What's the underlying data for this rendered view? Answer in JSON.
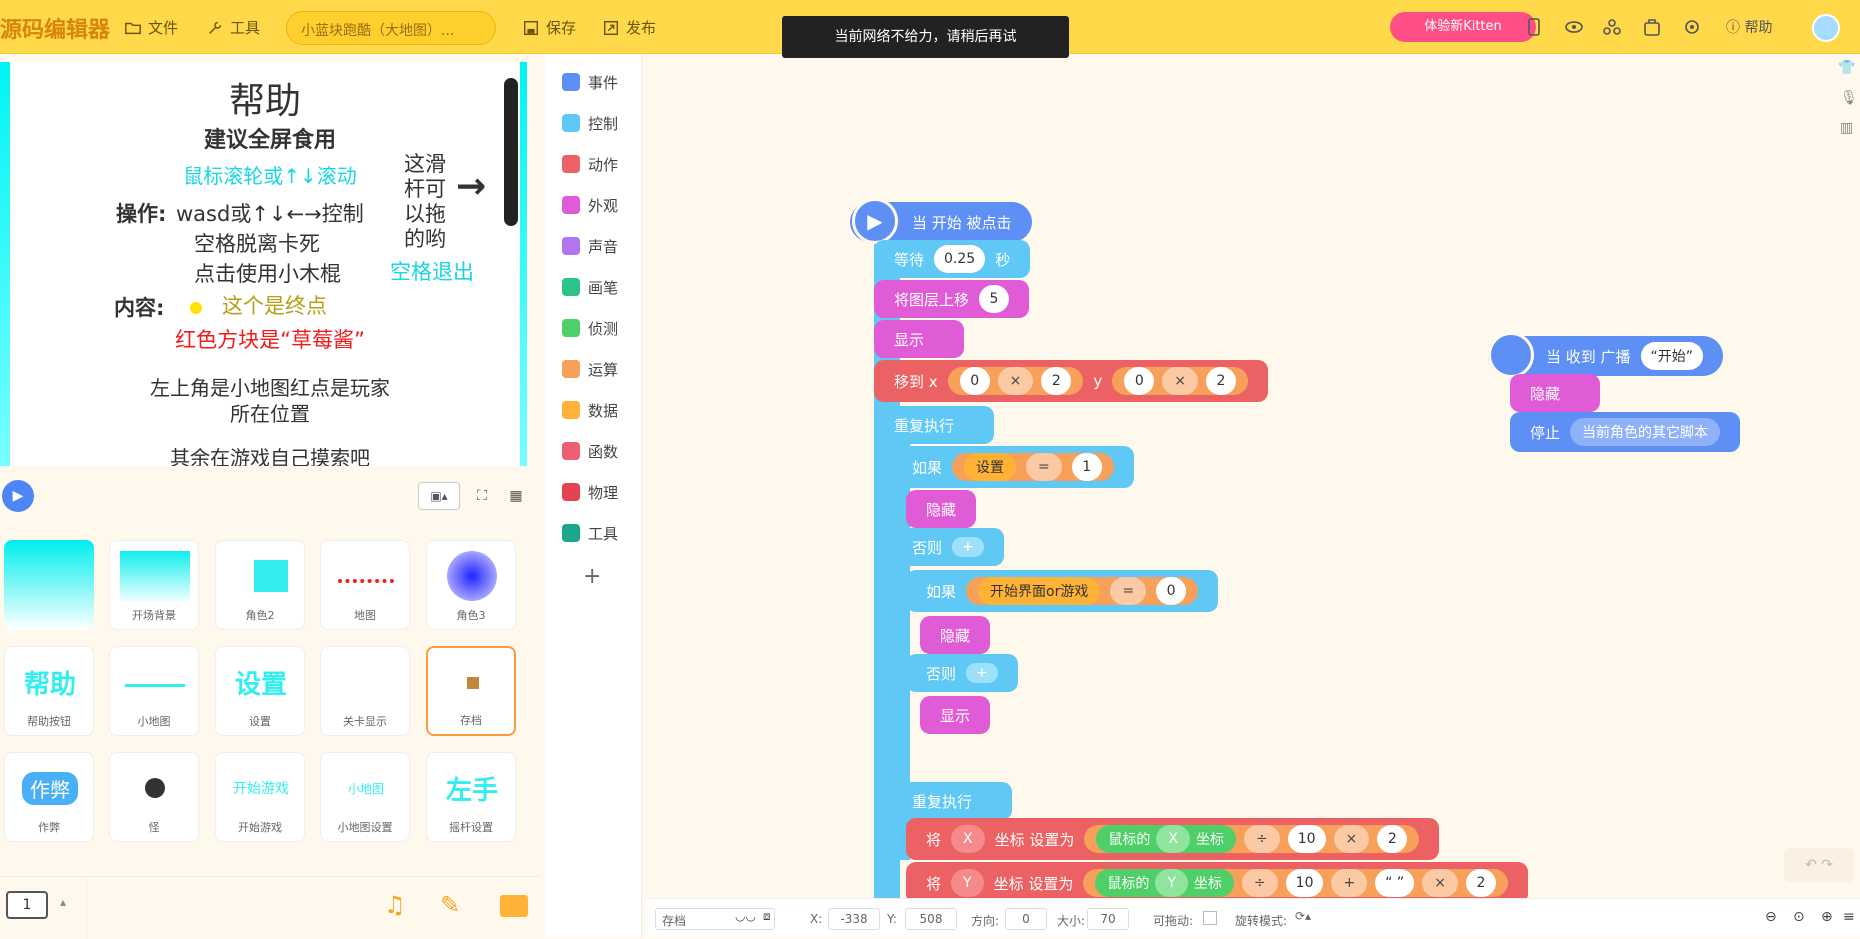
{
  "app": {
    "logo": "源码编辑器",
    "toast": "当前网络不给力，请稍后再试",
    "project_name": "小蓝块跑酷（大地图）...",
    "kitten_label": "体验新Kitten",
    "help_label": "帮助"
  },
  "toolbar": {
    "file_label": "文件",
    "tools_label": "工具",
    "save_label": "保存",
    "publish_label": "发布"
  },
  "stage": {
    "title": "帮助",
    "subtitle": "建议全屏食用",
    "scroll_tip": "鼠标滚轮或↑↓滚动",
    "ops_label": "操作:",
    "ops_1": "wasd或↑↓←→控制",
    "ops_2": "空格脱离卡死",
    "ops_3": "点击使用小木棍",
    "side_1": "这滑",
    "side_2": "杆可",
    "side_3": "以拖",
    "side_4": "的哟",
    "arrow": "→",
    "exit_tip": "空格退出",
    "content_label": "内容:",
    "content_1": "这个是终点",
    "content_2": "红色方块是“草莓酱”",
    "minimap_1": "左上角是小地图红点是玩家",
    "minimap_2": "所在位置",
    "explore": "其余在游戏自己摸索吧"
  },
  "sprites": [
    {
      "name": ""
    },
    {
      "name": "开场背景"
    },
    {
      "name": "角色2"
    },
    {
      "name": "地图"
    },
    {
      "name": "角色3"
    },
    {
      "name": "帮助按钮",
      "thumb_text": "帮助"
    },
    {
      "name": "小地图"
    },
    {
      "name": "设置",
      "thumb_text": "设置"
    },
    {
      "name": "关卡显示"
    },
    {
      "name": "存档"
    },
    {
      "name": "作弊",
      "thumb_text": "作弊"
    },
    {
      "name": "怪"
    },
    {
      "name": "开始游戏",
      "thumb_text": "开始游戏"
    },
    {
      "name": "小地图设置",
      "thumb_text": "小地图"
    },
    {
      "name": "摇杆设置",
      "thumb_text": "左手"
    }
  ],
  "scene_indicator": "1",
  "categories": [
    {
      "label": "事件",
      "color": "#5d8ff5"
    },
    {
      "label": "控制",
      "color": "#60c8f4"
    },
    {
      "label": "动作",
      "color": "#ec6163"
    },
    {
      "label": "外观",
      "color": "#df5cd6"
    },
    {
      "label": "声音",
      "color": "#b175f0"
    },
    {
      "label": "画笔",
      "color": "#2ec28b"
    },
    {
      "label": "侦测",
      "color": "#4fcf67"
    },
    {
      "label": "运算",
      "color": "#f6a05a"
    },
    {
      "label": "数据",
      "color": "#ffb235"
    },
    {
      "label": "函数",
      "color": "#ef5f74"
    },
    {
      "label": "物理",
      "color": "#e34452"
    },
    {
      "label": "工具",
      "color": "#1aa88c"
    }
  ],
  "add_category": "+",
  "blocks": {
    "hat_start": "当 开始 被点击",
    "wait": "等待",
    "wait_val": "0.25",
    "wait_unit": "秒",
    "layer_up": "将图层上移",
    "layer_val": "5",
    "show": "显示",
    "goto": "移到 x",
    "goto_x1": "0",
    "goto_op": "×",
    "goto_x2": "2",
    "goto_y": "y",
    "goto_y1": "0",
    "goto_y2": "2",
    "repeat": "重复执行",
    "if": "如果",
    "if_var": "设置",
    "eq": "=",
    "if_val": "1",
    "hide": "隐藏",
    "else": "否则",
    "plus": "+",
    "if2_var": "开始界面or游戏",
    "if2_val": "0",
    "repeat2": "重复执行",
    "set_prefix": "将",
    "set_axis_x": "X",
    "set_axis_y": "Y",
    "set_mid": "坐标 设置为",
    "mouse_prefix": "鼠标的",
    "mouse_suffix": "坐标",
    "div": "÷",
    "ten": "10",
    "mul": "×",
    "two": "2",
    "add": "+",
    "quote": "“ ”",
    "hat_recv": "当 收到 广播",
    "recv_msg": "“开始”",
    "stop": "停止",
    "stop_opt": "当前角色的其它脚本"
  },
  "status": {
    "sprite_name": "存档",
    "x_label": "X:",
    "x_val": "-338",
    "y_label": "Y:",
    "y_val": "508",
    "dir_label": "方向:",
    "dir_val": "0",
    "size_label": "大小:",
    "size_val": "70",
    "drag_label": "可拖动:",
    "rot_label": "旋转模式:"
  }
}
